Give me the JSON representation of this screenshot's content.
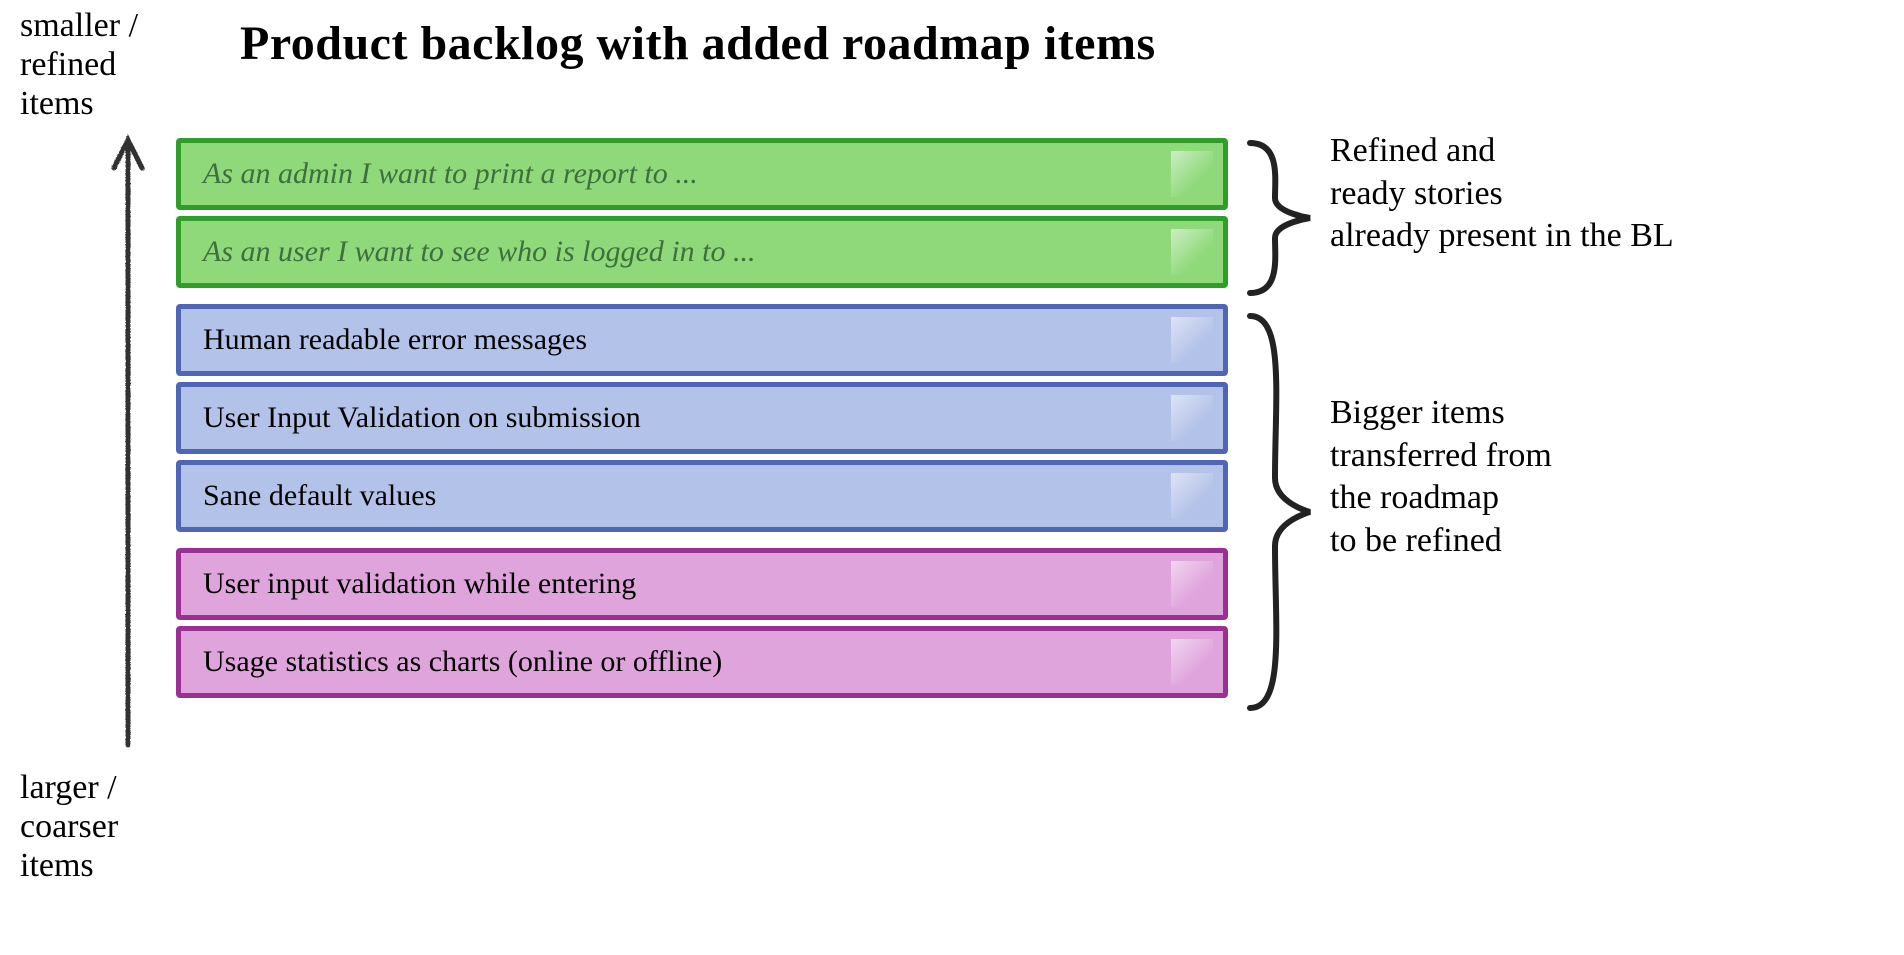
{
  "title": "Product backlog with added roadmap items",
  "axis": {
    "top": "smaller /\nrefined\nitems",
    "bottom": "larger /\ncoarser\nitems"
  },
  "items": [
    {
      "text": "As an admin I want to print a report to ...",
      "group": "green"
    },
    {
      "text": "As an user I want to see who is logged in to ...",
      "group": "green"
    },
    {
      "text": "Human readable error messages",
      "group": "blue"
    },
    {
      "text": "User Input Validation on submission",
      "group": "blue"
    },
    {
      "text": "Sane default values",
      "group": "blue"
    },
    {
      "text": "User input validation while entering",
      "group": "purple"
    },
    {
      "text": "Usage statistics as charts (online or offline)",
      "group": "purple"
    }
  ],
  "annotations": {
    "refined": "Refined and\n ready stories\nalready present in the BL",
    "bigger": "Bigger items\ntransferred from\nthe roadmap\nto be refined"
  },
  "colors": {
    "green_fill": "#8fd97a",
    "green_border": "#2f9d2a",
    "blue_fill": "#b3c2e8",
    "blue_border": "#4f66b4",
    "purple_fill": "#dfa4dc",
    "purple_border": "#9a2f94"
  }
}
